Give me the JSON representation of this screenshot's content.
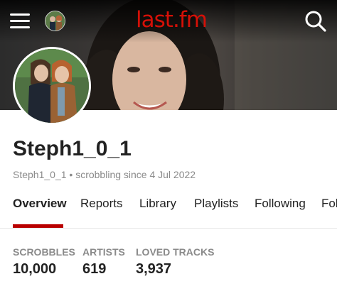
{
  "header": {
    "logo_text": "last.fm",
    "menu_icon": "hamburger-menu-icon",
    "search_icon": "search-icon"
  },
  "profile": {
    "username": "Steph1_0_1",
    "subtitle": "Steph1_0_1 • scrobbling since 4 Jul 2022"
  },
  "tabs": [
    {
      "label": "Overview",
      "active": true
    },
    {
      "label": "Reports"
    },
    {
      "label": "Library"
    },
    {
      "label": "Playlists"
    },
    {
      "label": "Following"
    },
    {
      "label": "Fol"
    }
  ],
  "stats": [
    {
      "label": "SCROBBLES",
      "value": "10,000"
    },
    {
      "label": "ARTISTS",
      "value": "619"
    },
    {
      "label": "LOVED TRACKS",
      "value": "3,937"
    }
  ],
  "colors": {
    "brand_red": "#d51007",
    "active_tab_underline": "#b90000",
    "muted_text": "#8a8a8a"
  }
}
